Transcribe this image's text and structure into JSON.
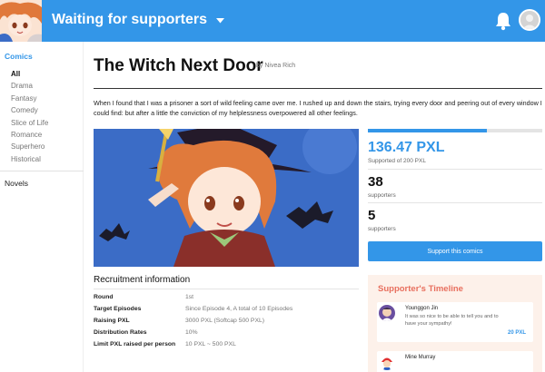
{
  "header": {
    "title": "Waiting for supporters",
    "colors": {
      "bar": "#3396e8",
      "text": "#ffffff"
    }
  },
  "sidebar": {
    "comics_label": "Comics",
    "items": [
      {
        "label": "All",
        "active": true
      },
      {
        "label": "Drama"
      },
      {
        "label": "Fantasy"
      },
      {
        "label": "Comedy"
      },
      {
        "label": "Slice of Life"
      },
      {
        "label": "Romance"
      },
      {
        "label": "Superhero"
      },
      {
        "label": "Historical"
      }
    ],
    "novels_label": "Novels"
  },
  "comic": {
    "title": "The Witch Next Door",
    "byline": "by Nivea Rich",
    "description": "When I found that I was a prisoner a sort of wild feeling came over me. I rushed up and down the stairs, trying every door and peering out of every window I could find: but after a little the conviction of my helplessness overpowered all other feelings."
  },
  "funding": {
    "progress_percent": 68,
    "amount": "136.47 PXL",
    "amount_sub": "Supported of 200 PXL",
    "supporters_total": "38",
    "supporters_total_label": "supporters",
    "supporters_recent": "5",
    "supporters_recent_label": "supporters",
    "support_button": "Support this comics"
  },
  "recruitment": {
    "title": "Recruitment information",
    "rows": [
      {
        "label": "Round",
        "value": "1st"
      },
      {
        "label": "Target Episodes",
        "value": "Since Episode 4, A total of 10 Episodes"
      },
      {
        "label": "Raising PXL",
        "value": "3000 PXL (Softcap 500 PXL)"
      },
      {
        "label": "Distribution Rates",
        "value": "10%"
      },
      {
        "label": "Limit PXL raised per person",
        "value": "10 PXL ~ 500 PXL"
      }
    ]
  },
  "timeline": {
    "title": "Supporter's Timeline",
    "entries": [
      {
        "name": "Younggon Jin",
        "message": "It was so nice to be able to tell you and to have your sympathy!",
        "amount": "20 PXL"
      },
      {
        "name": "Mine Murray",
        "message": ""
      }
    ]
  }
}
